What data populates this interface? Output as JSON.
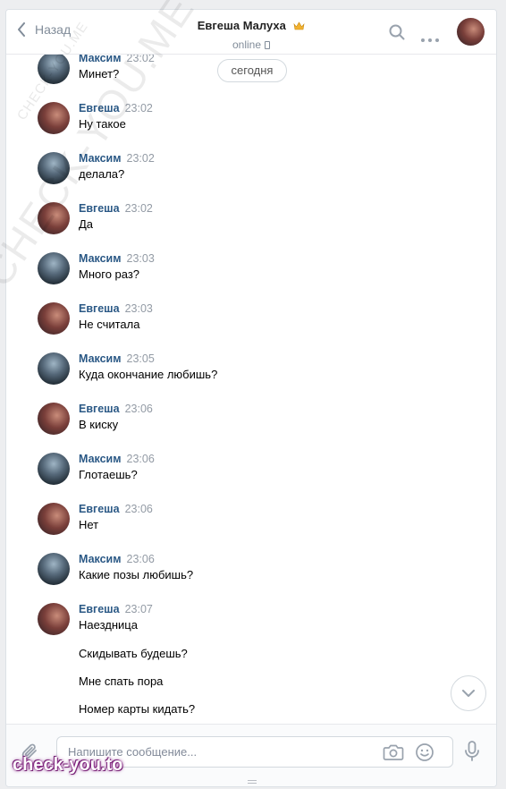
{
  "header": {
    "back_label": "Назад",
    "title": "Евгеша Малуха",
    "status": "online"
  },
  "date_pill": "сегодня",
  "messages": [
    {
      "author": "Максим",
      "time": "23:02",
      "text": "Минет?"
    },
    {
      "author": "Евгеша",
      "time": "23:02",
      "text": "Ну такое"
    },
    {
      "author": "Максим",
      "time": "23:02",
      "text": "делала?"
    },
    {
      "author": "Евгеша",
      "time": "23:02",
      "text": "Да"
    },
    {
      "author": "Максим",
      "time": "23:03",
      "text": "Много раз?"
    },
    {
      "author": "Евгеша",
      "time": "23:03",
      "text": "Не считала"
    },
    {
      "author": "Максим",
      "time": "23:05",
      "text": "Куда окончание любишь?"
    },
    {
      "author": "Евгеша",
      "time": "23:06",
      "text": "В киску"
    },
    {
      "author": "Максим",
      "time": "23:06",
      "text": "Глотаешь?"
    },
    {
      "author": "Евгеша",
      "time": "23:06",
      "text": "Нет"
    },
    {
      "author": "Максим",
      "time": "23:06",
      "text": "Какие позы любишь?"
    },
    {
      "author": "Евгеша",
      "time": "23:07",
      "text": "Наездница"
    }
  ],
  "continuation": [
    "Скидывать будешь?",
    "Мне спать пора",
    "Номер карты кидать?"
  ],
  "composer": {
    "placeholder": "Напишите сообщение..."
  },
  "watermarks": {
    "diagonal_big": "CHECK-YOU.ME",
    "diagonal_small": "CHECK-YOU.ME",
    "bottom": "check-you.to"
  },
  "colors": {
    "author": "#2a5885",
    "meta_time": "#939ba5",
    "page_bg": "#edeef0"
  }
}
